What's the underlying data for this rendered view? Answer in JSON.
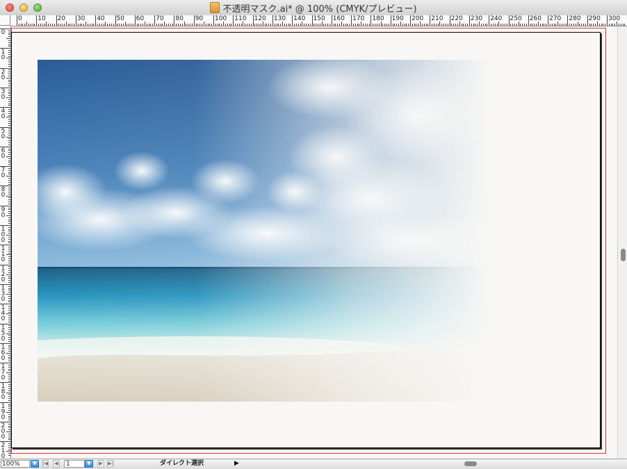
{
  "window": {
    "title": "不透明マスク.ai* @ 100% (CMYK/プレビュー)",
    "buttons": [
      "close",
      "minimize",
      "zoom"
    ],
    "doc_icon": "illustrator-doc-icon"
  },
  "rulers": {
    "top_labels": [
      "0",
      "10",
      "20",
      "30",
      "40",
      "50",
      "60",
      "70",
      "80",
      "90",
      "100",
      "110",
      "120",
      "130",
      "140",
      "150",
      "160",
      "170",
      "180",
      "190",
      "200",
      "210",
      "220",
      "230",
      "240",
      "250",
      "260",
      "270",
      "280",
      "290",
      "300"
    ],
    "left_labels": [
      "0",
      "10",
      "20",
      "30",
      "40",
      "50",
      "60",
      "70",
      "80",
      "90",
      "100",
      "110",
      "120",
      "130",
      "140",
      "150",
      "160",
      "170",
      "180",
      "190",
      "200",
      "210"
    ]
  },
  "canvas": {
    "bleed_color": "#e0353a",
    "artboard_content": "beach photo with opacity mask gradient fading to white on right"
  },
  "statusbar": {
    "zoom": "100%",
    "page": "1",
    "tool": "ダイレクト選択",
    "accent": "#2f8fdc"
  }
}
